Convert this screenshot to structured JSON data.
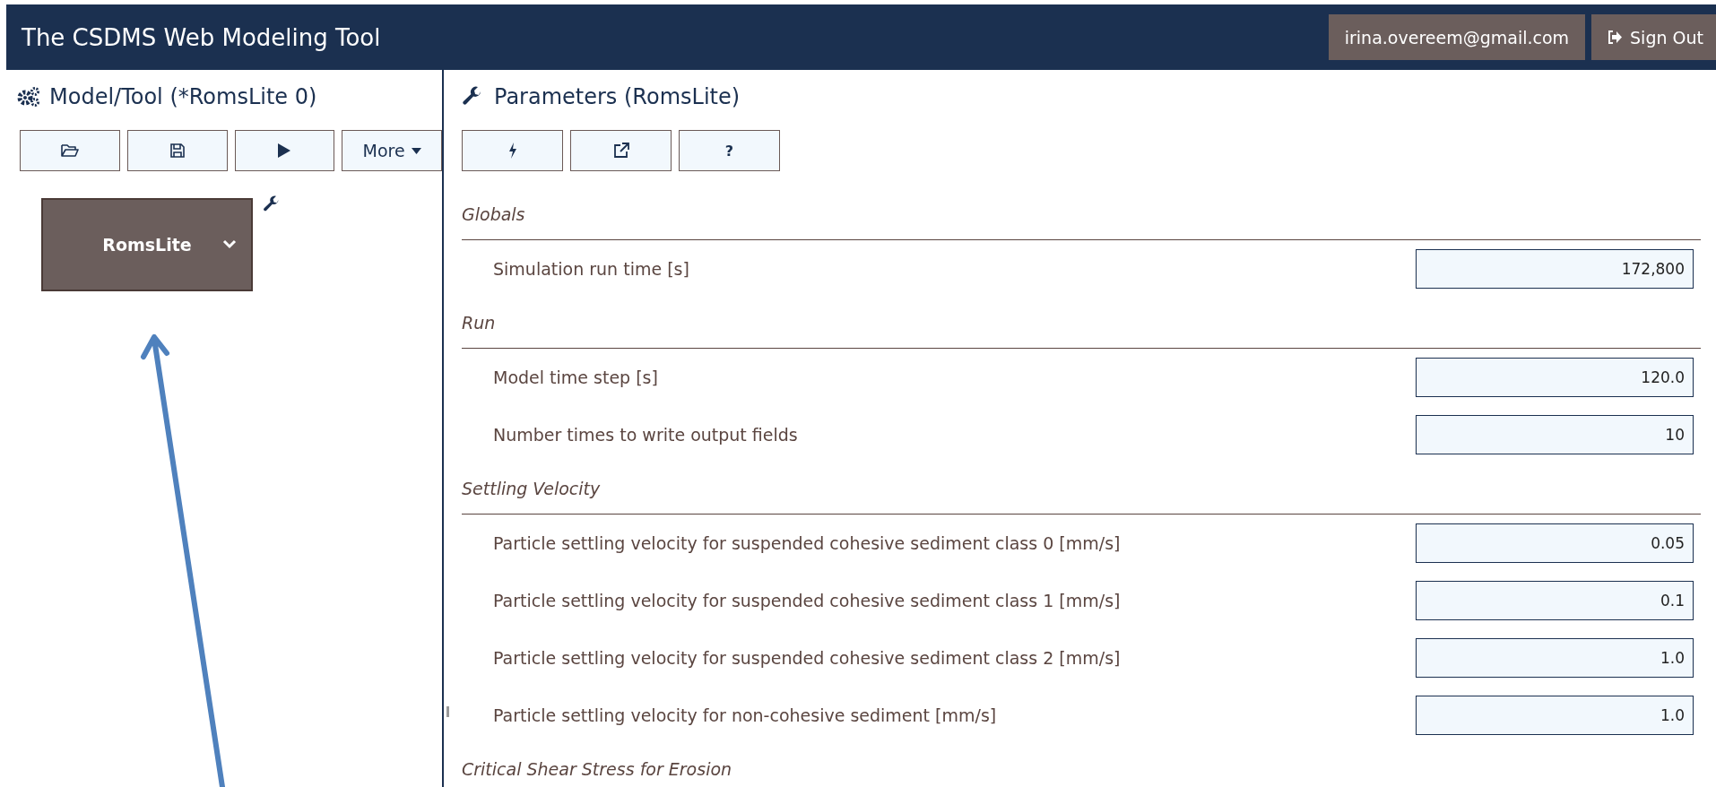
{
  "header": {
    "title": "The CSDMS Web Modeling Tool",
    "user": "irina.overeem@gmail.com",
    "sign_out": "Sign Out"
  },
  "model_panel": {
    "title": "Model/Tool (*RomsLite 0)",
    "toolbar": [
      {
        "kind": "open"
      },
      {
        "kind": "save"
      },
      {
        "kind": "run"
      },
      {
        "kind": "more",
        "label": "More"
      }
    ],
    "node": {
      "label": "RomsLite"
    }
  },
  "parameters_panel": {
    "title": "Parameters (RomsLite)",
    "toolbar": [
      {
        "kind": "lightning"
      },
      {
        "kind": "external"
      },
      {
        "kind": "help",
        "label": "?"
      }
    ],
    "sections": [
      {
        "title": "Globals",
        "params": [
          {
            "label": "Simulation run time [s]",
            "value": "172,800"
          }
        ]
      },
      {
        "title": "Run",
        "params": [
          {
            "label": "Model time step [s]",
            "value": "120.0"
          },
          {
            "label": "Number times to write output fields",
            "value": "10"
          }
        ]
      },
      {
        "title": "Settling Velocity",
        "params": [
          {
            "label": "Particle settling velocity for suspended cohesive sediment class 0 [mm/s]",
            "value": "0.05"
          },
          {
            "label": "Particle settling velocity for suspended cohesive sediment class 1 [mm/s]",
            "value": "0.1"
          },
          {
            "label": "Particle settling velocity for suspended cohesive sediment class 2 [mm/s]",
            "value": "1.0"
          },
          {
            "label": "Particle settling velocity for non-cohesive sediment [mm/s]",
            "value": "1.0"
          }
        ]
      },
      {
        "title": "Critical Shear Stress for Erosion"
      }
    ]
  }
}
